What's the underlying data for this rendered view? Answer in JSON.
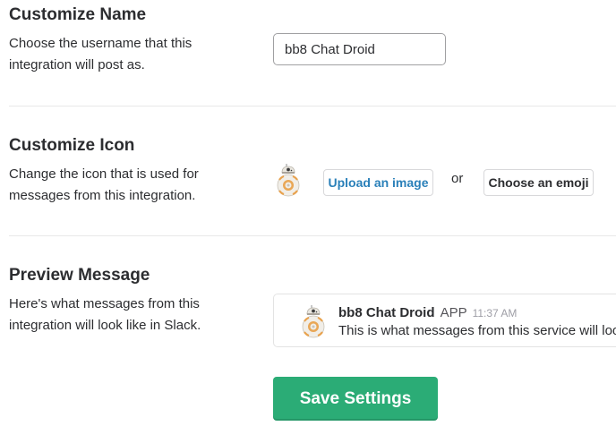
{
  "customize_name": {
    "title": "Customize Name",
    "description": "Choose the username that this integration will post as.",
    "username_value": "bb8 Chat Droid"
  },
  "customize_icon": {
    "title": "Customize Icon",
    "description": "Change the icon that is used for messages from this integration.",
    "avatar_icon": "bb8-droid-icon",
    "upload_label": "Upload an image",
    "or_label": "or",
    "emoji_label": "Choose an emoji"
  },
  "preview": {
    "title": "Preview Message",
    "description": "Here's what messages from this integration will look like in Slack.",
    "sender": "bb8 Chat Droid",
    "badge": "APP",
    "timestamp": "11:37 AM",
    "message": "This is what messages from this service will look like in Slack."
  },
  "save_label": "Save Settings",
  "colors": {
    "accent_green": "#2bac76",
    "link_blue": "#2a80b9",
    "text": "#2c2d30"
  }
}
